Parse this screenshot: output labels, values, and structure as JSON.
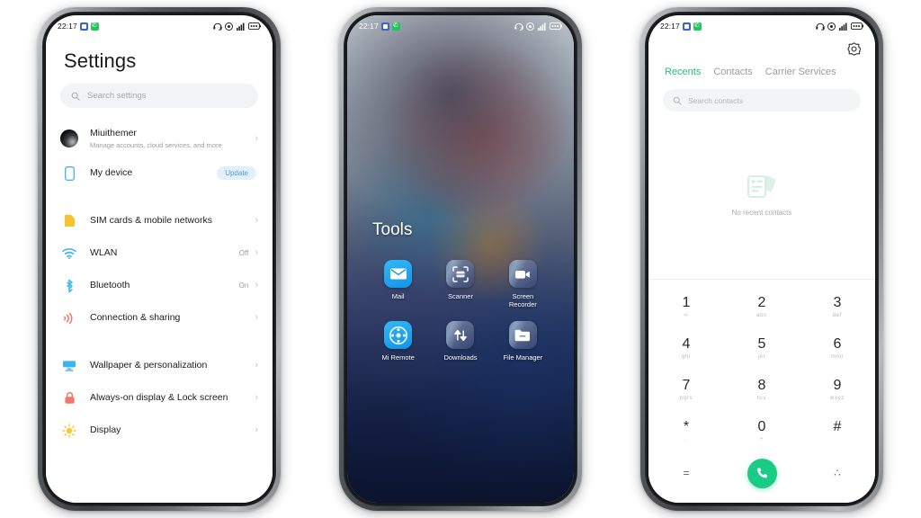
{
  "meta": {
    "background_color": "#ffffff",
    "accent_green": "#19cb85",
    "accent_blue": "#5599d6"
  },
  "status_bar": {
    "time": "22:17",
    "left_icons": [
      "app-blue-icon",
      "phone-green-icon"
    ],
    "right_icons": [
      "headset-icon",
      "dnd-icon",
      "signal-icon",
      "battery-icon"
    ]
  },
  "phone1": {
    "screen_name": "Settings",
    "title": "Settings",
    "search": {
      "placeholder": "Search settings",
      "icon": "search-icon"
    },
    "account": {
      "name": "Miuithemer",
      "subtitle": "Manage accounts, cloud services, and more",
      "chevron": "›"
    },
    "items": [
      {
        "label": "My device",
        "icon": "device-icon",
        "badge": "Update",
        "value": "",
        "chevron": ""
      },
      {
        "label": "SIM cards & mobile networks",
        "icon": "sim-icon",
        "badge": "",
        "value": "",
        "chevron": "›"
      },
      {
        "label": "WLAN",
        "icon": "wifi-icon",
        "badge": "",
        "value": "Off",
        "chevron": "›"
      },
      {
        "label": "Bluetooth",
        "icon": "bluetooth-icon",
        "badge": "",
        "value": "On",
        "chevron": "›"
      },
      {
        "label": "Connection & sharing",
        "icon": "connection-sharing-icon",
        "badge": "",
        "value": "",
        "chevron": "›"
      },
      {
        "label": "Wallpaper & personalization",
        "icon": "wallpaper-icon",
        "badge": "",
        "value": "",
        "chevron": "›"
      },
      {
        "label": "Always-on display & Lock screen",
        "icon": "lock-icon",
        "badge": "",
        "value": "",
        "chevron": "›"
      },
      {
        "label": "Display",
        "icon": "display-brightness-icon",
        "badge": "",
        "value": "",
        "chevron": "›"
      }
    ]
  },
  "phone2": {
    "screen_name": "Home screen folder",
    "folder_title": "Tools",
    "apps": [
      {
        "label": "Mail",
        "icon": "mail-icon",
        "style": "blue"
      },
      {
        "label": "Scanner",
        "icon": "scanner-icon",
        "style": "translucent"
      },
      {
        "label": "Screen Recorder",
        "icon": "screen-recorder-icon",
        "style": "translucent"
      },
      {
        "label": "Mi Remote",
        "icon": "remote-control-icon",
        "style": "blue"
      },
      {
        "label": "Downloads",
        "icon": "downloads-icon",
        "style": "translucent"
      },
      {
        "label": "File Manager",
        "icon": "folder-icon",
        "style": "translucent"
      }
    ]
  },
  "phone3": {
    "screen_name": "Phone dialer",
    "settings_icon": "gear-icon",
    "tabs": [
      {
        "label": "Recents",
        "active": true
      },
      {
        "label": "Contacts",
        "active": false
      },
      {
        "label": "Carrier Services",
        "active": false
      }
    ],
    "search": {
      "placeholder": "Search contacts",
      "icon": "search-icon"
    },
    "empty_state": {
      "icon": "no-contacts-icon",
      "text": "No recent contacts"
    },
    "keypad": [
      {
        "num": "1",
        "sub": "∞"
      },
      {
        "num": "2",
        "sub": "abc"
      },
      {
        "num": "3",
        "sub": "def"
      },
      {
        "num": "4",
        "sub": "ghi"
      },
      {
        "num": "5",
        "sub": "jkl"
      },
      {
        "num": "6",
        "sub": "mno"
      },
      {
        "num": "7",
        "sub": "pqrs"
      },
      {
        "num": "8",
        "sub": "tuv"
      },
      {
        "num": "9",
        "sub": "wxyz"
      },
      {
        "num": "*",
        "sub": ","
      },
      {
        "num": "0",
        "sub": "+"
      },
      {
        "num": "#",
        "sub": ""
      }
    ],
    "bottom_row": {
      "left": "=",
      "call_icon": "call-icon",
      "right": "∴"
    }
  }
}
